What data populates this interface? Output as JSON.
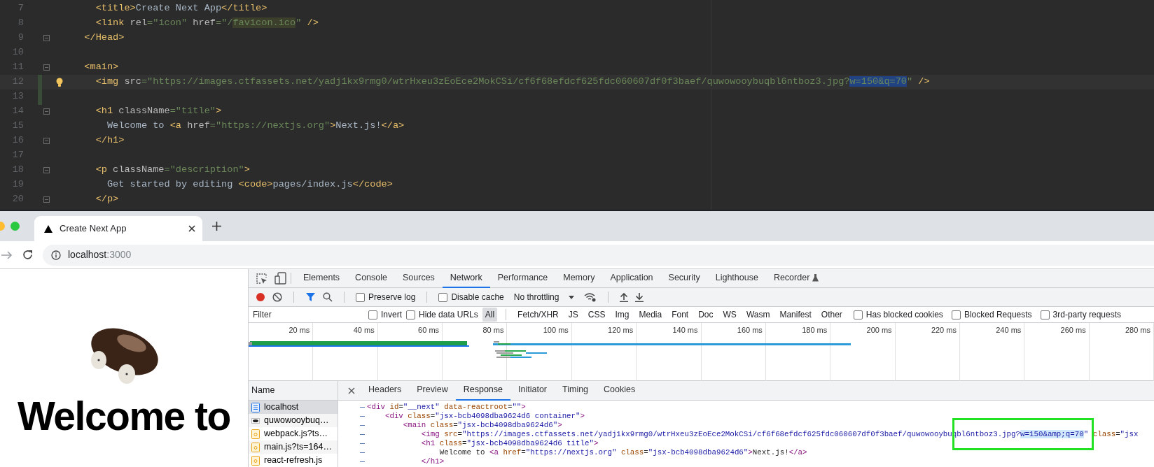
{
  "editor": {
    "lines": [
      {
        "number": "7",
        "fold": false,
        "changed": false,
        "current": false,
        "bulb": false,
        "segments": [
          {
            "kind": "tag",
            "text": "    <title>"
          },
          {
            "kind": "text",
            "text": "Create Next App"
          },
          {
            "kind": "tag",
            "text": "</title>"
          }
        ]
      },
      {
        "number": "8",
        "fold": false,
        "changed": false,
        "current": false,
        "bulb": false,
        "segments": [
          {
            "kind": "tag",
            "text": "    <link"
          },
          {
            "kind": "attr",
            "text": " rel"
          },
          {
            "kind": "string",
            "text": "=\"icon\""
          },
          {
            "kind": "attr",
            "text": " href"
          },
          {
            "kind": "string",
            "text": "=\"/"
          },
          {
            "kind": "string-marked",
            "text": "favicon.ico"
          },
          {
            "kind": "string",
            "text": "\""
          },
          {
            "kind": "tag",
            "text": " />"
          }
        ]
      },
      {
        "number": "9",
        "fold": true,
        "changed": false,
        "current": false,
        "bulb": false,
        "segments": [
          {
            "kind": "tag",
            "text": "  </Head>"
          }
        ]
      },
      {
        "number": "10",
        "fold": false,
        "changed": false,
        "current": false,
        "bulb": false
      },
      {
        "number": "11",
        "fold": true,
        "changed": false,
        "current": false,
        "bulb": false,
        "segments": [
          {
            "kind": "tag",
            "text": "  <main>"
          }
        ]
      },
      {
        "number": "12",
        "fold": false,
        "changed": true,
        "current": true,
        "bulb": true,
        "segments": [
          {
            "kind": "tag",
            "text": "    <img"
          },
          {
            "kind": "attr",
            "text": " src"
          },
          {
            "kind": "string",
            "text": "=\"https://images.ctfassets.net/yadj1kx9rmg0/wtrHxeu3zEoEce2MokCSi/cf6f68efdcf625fdc060607df0f3baef/quwowooybuqbl6ntboz3.jpg?"
          },
          {
            "kind": "string-selected",
            "text": "w=150&q=70"
          },
          {
            "kind": "string",
            "text": "\""
          },
          {
            "kind": "tag",
            "text": " />"
          }
        ]
      },
      {
        "number": "13",
        "fold": false,
        "changed": true,
        "current": false,
        "bulb": false
      },
      {
        "number": "14",
        "fold": true,
        "changed": false,
        "current": false,
        "bulb": false,
        "segments": [
          {
            "kind": "tag",
            "text": "    <h1"
          },
          {
            "kind": "attr",
            "text": " className"
          },
          {
            "kind": "string",
            "text": "=\"title\""
          },
          {
            "kind": "tag",
            "text": ">"
          }
        ]
      },
      {
        "number": "15",
        "fold": false,
        "changed": false,
        "current": false,
        "bulb": false,
        "segments": [
          {
            "kind": "text",
            "text": "      Welcome to "
          },
          {
            "kind": "tag",
            "text": "<a"
          },
          {
            "kind": "attr",
            "text": " href"
          },
          {
            "kind": "string",
            "text": "=\"https://nextjs.org\""
          },
          {
            "kind": "tag",
            "text": ">"
          },
          {
            "kind": "text",
            "text": "Next.js!"
          },
          {
            "kind": "tag",
            "text": "</a>"
          }
        ]
      },
      {
        "number": "16",
        "fold": true,
        "changed": false,
        "current": false,
        "bulb": false,
        "segments": [
          {
            "kind": "tag",
            "text": "    </h1>"
          }
        ]
      },
      {
        "number": "17",
        "fold": false,
        "changed": false,
        "current": false,
        "bulb": false
      },
      {
        "number": "18",
        "fold": true,
        "changed": false,
        "current": false,
        "bulb": false,
        "segments": [
          {
            "kind": "tag",
            "text": "    <p"
          },
          {
            "kind": "attr",
            "text": " className"
          },
          {
            "kind": "string",
            "text": "=\"description\""
          },
          {
            "kind": "tag",
            "text": ">"
          }
        ]
      },
      {
        "number": "19",
        "fold": false,
        "changed": false,
        "current": false,
        "bulb": false,
        "segments": [
          {
            "kind": "text",
            "text": "      Get started by editing "
          },
          {
            "kind": "tag",
            "text": "<code>"
          },
          {
            "kind": "text",
            "text": "pages/index.js"
          },
          {
            "kind": "tag",
            "text": "</code>"
          }
        ]
      },
      {
        "number": "20",
        "fold": true,
        "changed": false,
        "current": false,
        "bulb": false,
        "segments": [
          {
            "kind": "tag",
            "text": "    </p>"
          }
        ]
      }
    ]
  },
  "browser": {
    "tab": {
      "title": "Create Next App"
    },
    "address": {
      "host": "localhost",
      "port": ":3000"
    }
  },
  "page": {
    "heading": "Welcome to"
  },
  "devtools": {
    "tabs": [
      {
        "label": "Elements",
        "selected": false
      },
      {
        "label": "Console",
        "selected": false
      },
      {
        "label": "Sources",
        "selected": false
      },
      {
        "label": "Network",
        "selected": true
      },
      {
        "label": "Performance",
        "selected": false
      },
      {
        "label": "Memory",
        "selected": false
      },
      {
        "label": "Application",
        "selected": false
      },
      {
        "label": "Security",
        "selected": false
      },
      {
        "label": "Lighthouse",
        "selected": false
      },
      {
        "label": "Recorder",
        "selected": false,
        "experimental": true
      }
    ],
    "toolbar": {
      "preserve_log": {
        "label": "Preserve log",
        "checked": false
      },
      "disable_cache": {
        "label": "Disable cache",
        "checked": false
      },
      "throttling": "No throttling"
    },
    "filter": {
      "placeholder": "Filter",
      "invert": {
        "label": "Invert",
        "checked": false
      },
      "hide_data_urls": {
        "label": "Hide data URLs",
        "checked": false
      },
      "types": [
        {
          "label": "All",
          "selected": true
        },
        {
          "label": "Fetch/XHR",
          "selected": false
        },
        {
          "label": "JS",
          "selected": false
        },
        {
          "label": "CSS",
          "selected": false
        },
        {
          "label": "Img",
          "selected": false
        },
        {
          "label": "Media",
          "selected": false
        },
        {
          "label": "Font",
          "selected": false
        },
        {
          "label": "Doc",
          "selected": false
        },
        {
          "label": "WS",
          "selected": false
        },
        {
          "label": "Wasm",
          "selected": false
        },
        {
          "label": "Manifest",
          "selected": false
        },
        {
          "label": "Other",
          "selected": false
        }
      ],
      "options": [
        {
          "label": "Has blocked cookies",
          "checked": false
        },
        {
          "label": "Blocked Requests",
          "checked": false
        },
        {
          "label": "3rd-party requests",
          "checked": false
        }
      ]
    },
    "timeline": {
      "ticks": [
        "20 ms",
        "40 ms",
        "60 ms",
        "80 ms",
        "100 ms",
        "120 ms",
        "140 ms",
        "160 ms",
        "180 ms",
        "200 ms",
        "220 ms",
        "240 ms",
        "260 ms",
        "280 ms"
      ]
    },
    "requests": {
      "header": "Name",
      "items": [
        {
          "name": "localhost",
          "kind": "document",
          "selected": true
        },
        {
          "name": "quwowooybuq…",
          "kind": "image",
          "selected": false
        },
        {
          "name": "webpack.js?ts…",
          "kind": "script",
          "selected": false
        },
        {
          "name": "main.js?ts=164…",
          "kind": "script",
          "selected": false
        },
        {
          "name": "react-refresh.js",
          "kind": "script",
          "selected": false
        }
      ]
    },
    "detail": {
      "tabs": [
        {
          "label": "Headers",
          "selected": false
        },
        {
          "label": "Preview",
          "selected": false
        },
        {
          "label": "Response",
          "selected": true
        },
        {
          "label": "Initiator",
          "selected": false
        },
        {
          "label": "Timing",
          "selected": false
        },
        {
          "label": "Cookies",
          "selected": false
        }
      ],
      "lines": [
        [
          {
            "kind": "tag",
            "text": "<div"
          },
          {
            "kind": "attr",
            "text": " id"
          },
          {
            "kind": "text",
            "text": "="
          },
          {
            "kind": "string",
            "text": "\"__next\""
          },
          {
            "kind": "attr",
            "text": " data-reactroot"
          },
          {
            "kind": "text",
            "text": "="
          },
          {
            "kind": "string",
            "text": "\"\""
          },
          {
            "kind": "tag",
            "text": ">"
          }
        ],
        [
          {
            "kind": "tag",
            "text": "    <div"
          },
          {
            "kind": "attr",
            "text": " class"
          },
          {
            "kind": "text",
            "text": "="
          },
          {
            "kind": "string",
            "text": "\"jsx-bcb4098dba9624d6 container\""
          },
          {
            "kind": "tag",
            "text": ">"
          }
        ],
        [
          {
            "kind": "tag",
            "text": "        <main"
          },
          {
            "kind": "attr",
            "text": " class"
          },
          {
            "kind": "text",
            "text": "="
          },
          {
            "kind": "string",
            "text": "\"jsx-bcb4098dba9624d6\""
          },
          {
            "kind": "tag",
            "text": ">"
          }
        ],
        [
          {
            "kind": "tag",
            "text": "            <img"
          },
          {
            "kind": "attr",
            "text": " src"
          },
          {
            "kind": "text",
            "text": "="
          },
          {
            "kind": "string",
            "text": "\"https://images.ctfassets.net/yadj1kx9rmg0/wtrHxeu3zEoEce2MokCSi/cf6f68efdcf625fdc060607df0f3baef/quwowooybuq"
          },
          {
            "kind": "string-framed",
            "text": "bl6ntboz3.jpg?"
          },
          {
            "kind": "string-selected-framed",
            "text": "w=150&amp;q=70"
          },
          {
            "kind": "string-framed",
            "text": "\""
          },
          {
            "kind": "attr",
            "text": " class"
          },
          {
            "kind": "text",
            "text": "="
          },
          {
            "kind": "string",
            "text": "\"jsx"
          }
        ],
        [
          {
            "kind": "tag",
            "text": "            <h1"
          },
          {
            "kind": "attr",
            "text": " class"
          },
          {
            "kind": "text",
            "text": "="
          },
          {
            "kind": "string",
            "text": "\"jsx-bcb4098dba9624d6 title\""
          },
          {
            "kind": "tag",
            "text": ">"
          }
        ],
        [
          {
            "kind": "text",
            "text": "                Welcome to "
          },
          {
            "kind": "tag",
            "text": "<a"
          },
          {
            "kind": "attr",
            "text": " href"
          },
          {
            "kind": "text",
            "text": "="
          },
          {
            "kind": "string",
            "text": "\"https://nextjs.org\""
          },
          {
            "kind": "attr",
            "text": " class"
          },
          {
            "kind": "text",
            "text": "="
          },
          {
            "kind": "string",
            "text": "\"jsx-bcb4098dba9624d6\""
          },
          {
            "kind": "tag",
            "text": ">"
          },
          {
            "kind": "text",
            "text": "Next.js!"
          },
          {
            "kind": "tag",
            "text": "</a>"
          }
        ],
        [
          {
            "kind": "tag",
            "text": "            </h1>"
          }
        ]
      ]
    }
  }
}
